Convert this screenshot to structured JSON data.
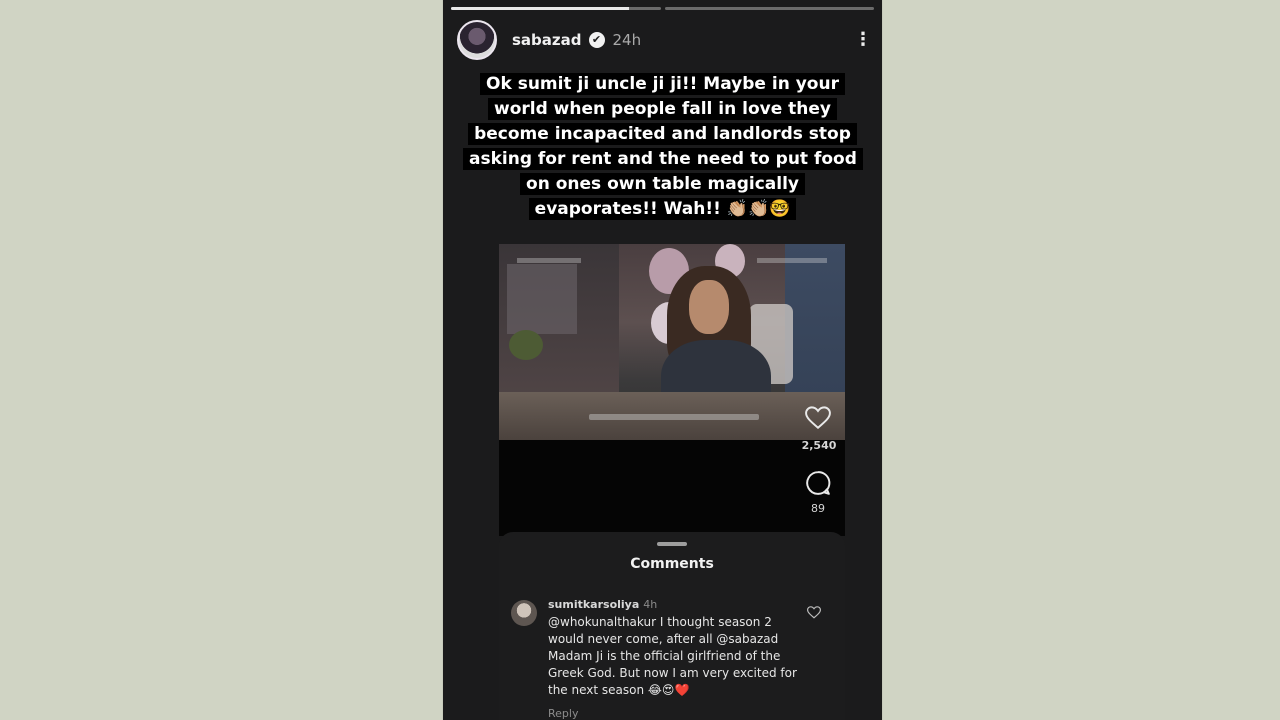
{
  "story": {
    "progress": [
      0.85,
      0.0
    ],
    "user": {
      "username": "sabazad",
      "verified_badge": "✔",
      "time": "24h",
      "more_icon": "⋮"
    },
    "caption": "Ok sumit ji uncle ji ji!! Maybe in your world when people fall in love they become incapacited and landlords stop asking for rent and the need to put food on ones own table magically evaporates!! Wah!! 👏🏼👏🏼🤓"
  },
  "post": {
    "likes": "2,540",
    "comments_count": "89",
    "icons": [
      "heart-icon",
      "comment-icon"
    ]
  },
  "comments_sheet": {
    "title": "Comments",
    "comment": {
      "username": "sumitkarsoliya",
      "time": "4h",
      "text": "@whokunalthakur I thought season 2 would never come, after all @sabazad Madam Ji is the official girlfriend of the Greek God. But now I am very excited for the next season 😂😍❤️",
      "reply_label": "Reply"
    }
  },
  "colors": {
    "background": "#d0d4c4",
    "story_bg": "#1b1b1c",
    "caption_bg": "#000000"
  }
}
